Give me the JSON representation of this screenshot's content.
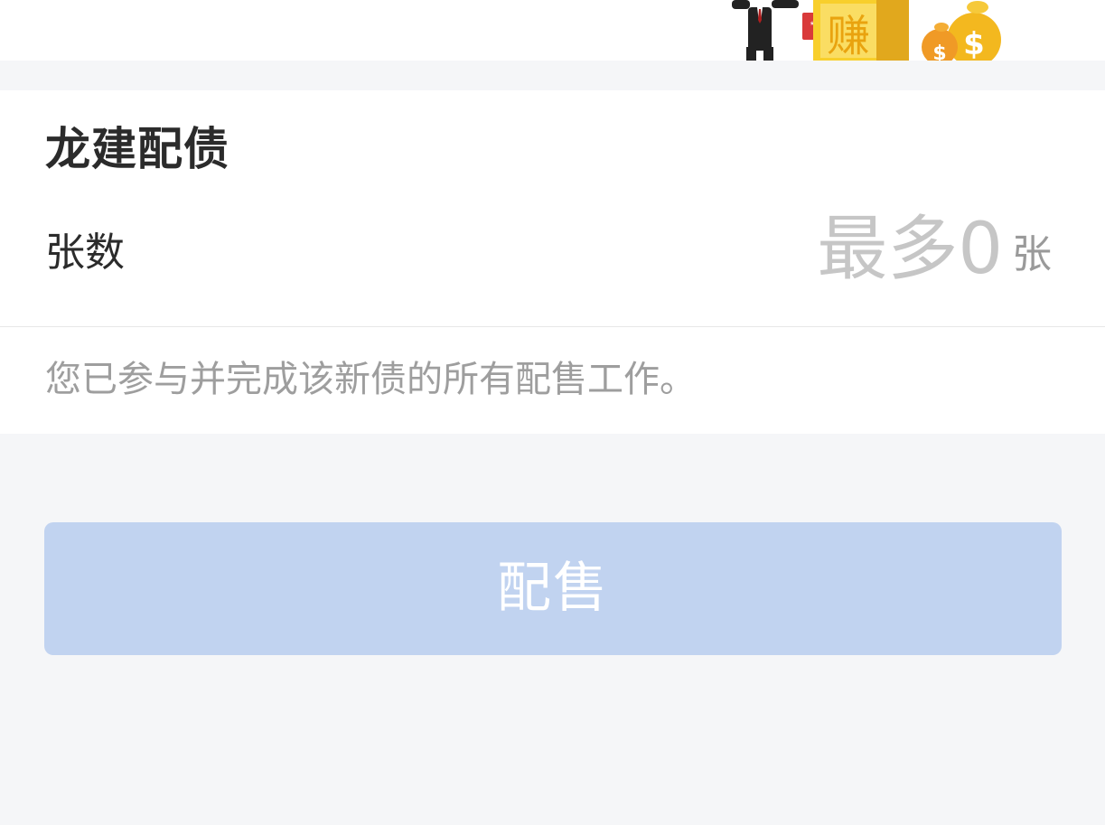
{
  "banner": {
    "illustration_text": "赚",
    "money_symbol": "$"
  },
  "bond": {
    "title": "龙建配债"
  },
  "quantity": {
    "label": "张数",
    "placeholder": "最多0",
    "value": "",
    "unit": "张"
  },
  "notice": "您已参与并完成该新债的所有配售工作。",
  "submit": {
    "label": "配售",
    "disabled": true
  },
  "colors": {
    "page_bg": "#f5f6f8",
    "button_disabled": "#c1d3f0",
    "notice_text": "#9e9e9e",
    "accent_gold": "#f2b800"
  }
}
